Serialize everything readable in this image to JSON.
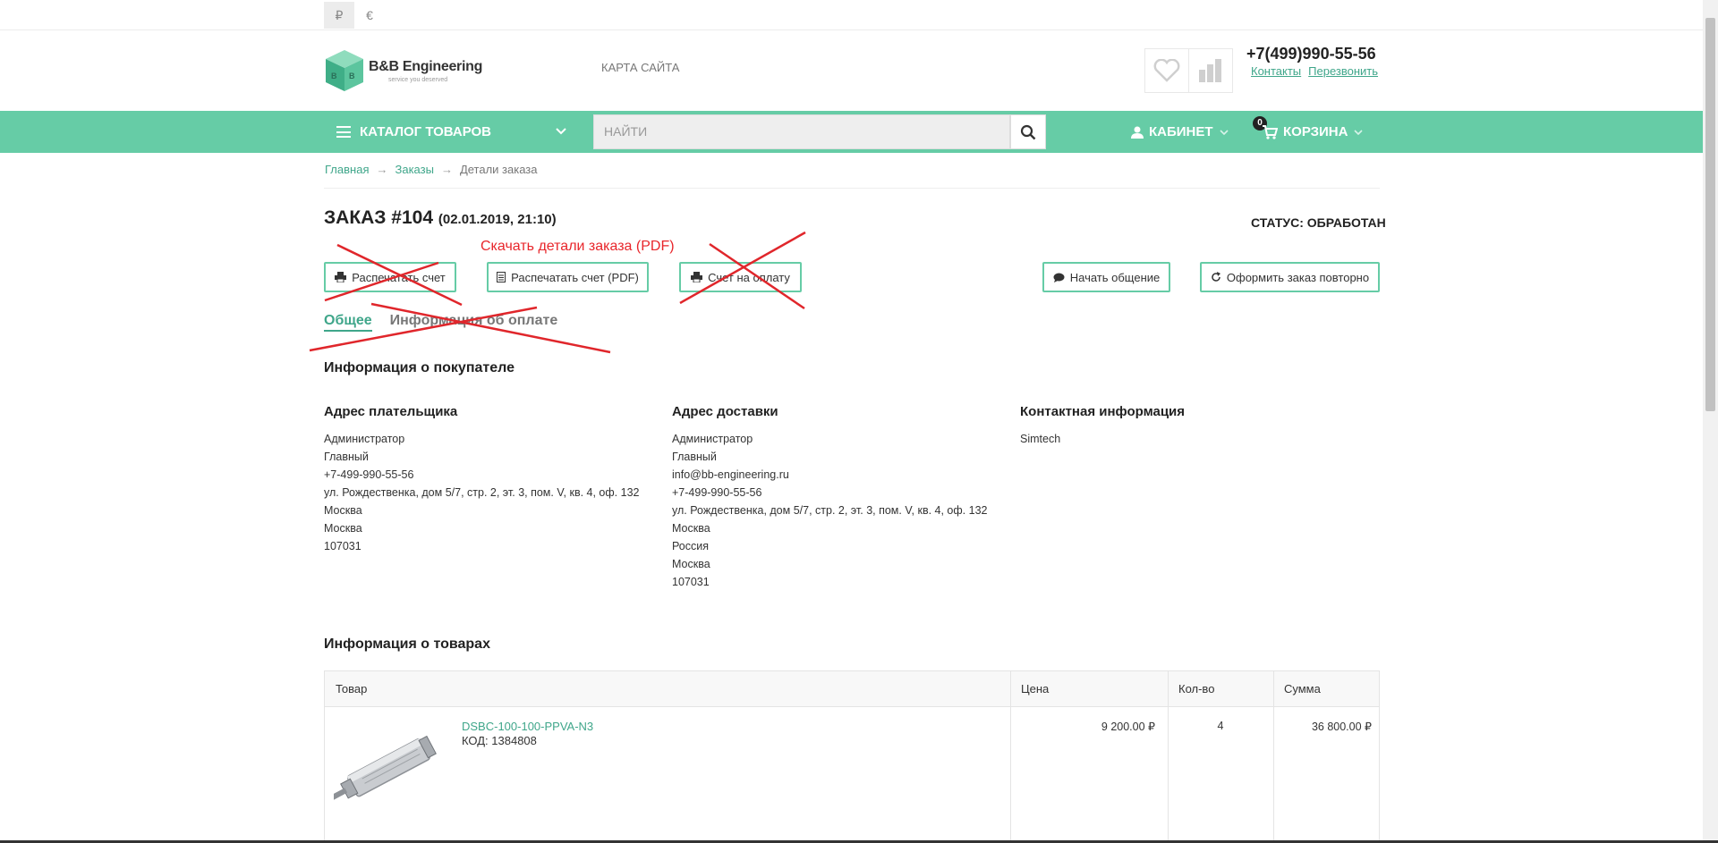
{
  "currency": [
    "₽",
    "€"
  ],
  "header": {
    "logo_text": "B&B Engineering",
    "logo_sub": "service you deserved",
    "sitemap": "КАРТА САЙТА",
    "phone": "+7(499)990-55-56",
    "contacts": "Контакты",
    "callback": "Перезвонить"
  },
  "nav": {
    "catalog": "КАТАЛОГ ТОВАРОВ",
    "search_placeholder": "НАЙТИ",
    "cabinet": "КАБИНЕТ",
    "cart": "КОРЗИНА",
    "cart_count": "0"
  },
  "breadcrumb": [
    "Главная",
    "Заказы",
    "Детали заказа"
  ],
  "breadcrumb_sep": "→",
  "order": {
    "title": "ЗАКАЗ #104",
    "date": "(02.01.2019, 21:10)",
    "status": "СТАТУС: ОБРАБОТАН",
    "pdf_note": "Скачать  детали заказа (PDF)"
  },
  "buttons": {
    "print_invoice": "Распечатать счет",
    "print_pdf": "Распечатать счет (PDF)",
    "invoice_payment": "Счет на оплату",
    "start_chat": "Начать общение",
    "reorder": "Оформить заказ повторно"
  },
  "tabs": [
    "Общее",
    "Информация об оплате"
  ],
  "customer": {
    "heading": "Информация о покупателе",
    "billing": {
      "title": "Адрес плательщика",
      "lines": [
        "Администратор",
        "Главный",
        "+7-499-990-55-56",
        "ул. Рождественка, дом 5/7, стр. 2, эт. 3, пом. V, кв. 4, оф. 132",
        "Москва",
        "Москва",
        "107031"
      ]
    },
    "shipping": {
      "title": "Адрес доставки",
      "lines": [
        "Администратор",
        "Главный",
        "info@bb-engineering.ru",
        "+7-499-990-55-56",
        "ул. Рождественка, дом 5/7, стр. 2, эт. 3, пом. V, кв. 4, оф. 132",
        "Москва",
        "Россия",
        "Москва",
        "107031"
      ]
    },
    "contact": {
      "title": "Контактная информация",
      "lines": [
        "Simtech"
      ]
    }
  },
  "products": {
    "heading": "Информация о товарах",
    "columns": [
      "Товар",
      "Цена",
      "Кол-во",
      "Сумма"
    ],
    "rows": [
      {
        "name": "DSBC-100-100-PPVA-N3",
        "code": "КОД: 1384808",
        "price": "9 200.00 ₽",
        "qty": "4",
        "sum": "36 800.00 ₽"
      }
    ]
  },
  "colors": {
    "accent": "#66cca6",
    "link": "#3fa68a",
    "annotation": "#e8262b"
  },
  "icons": [
    "heart-icon",
    "compare-icon",
    "search-icon",
    "user-icon",
    "cart-icon",
    "print-icon",
    "pdf-icon",
    "chat-icon",
    "refresh-icon"
  ]
}
